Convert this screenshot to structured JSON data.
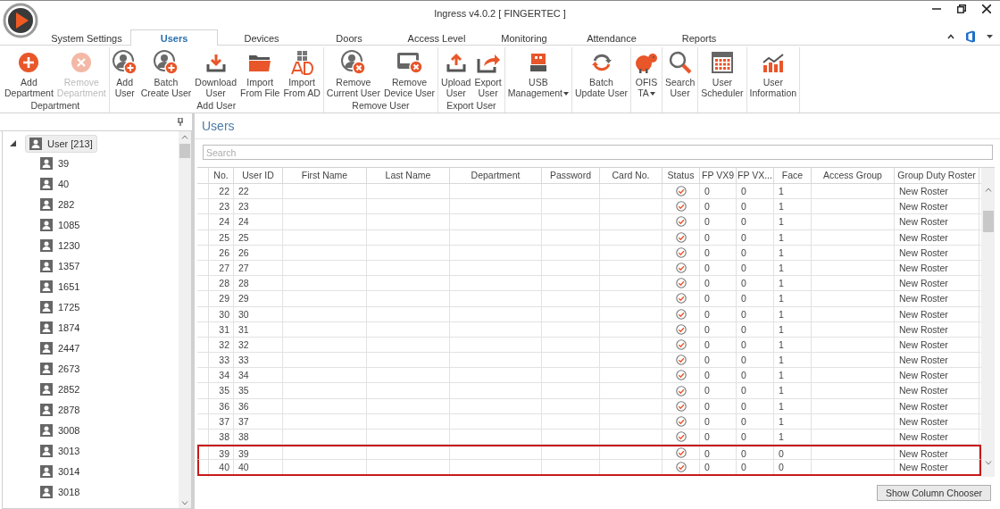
{
  "app": {
    "title": "Ingress v4.0.2 [ FINGERTEC ]"
  },
  "tabs": [
    {
      "label": "System Settings",
      "selected": false
    },
    {
      "label": "Users",
      "selected": true
    },
    {
      "label": "Devices",
      "selected": false
    },
    {
      "label": "Doors",
      "selected": false
    },
    {
      "label": "Access Level",
      "selected": false
    },
    {
      "label": "Monitoring",
      "selected": false
    },
    {
      "label": "Attendance",
      "selected": false
    },
    {
      "label": "Reports",
      "selected": false
    }
  ],
  "ribbon": {
    "groups": [
      {
        "label": "Department",
        "buttons": [
          {
            "label": "Add\nDepartment",
            "disabled": false
          },
          {
            "label": "Remove\nDepartment",
            "disabled": true
          }
        ]
      },
      {
        "label": "Add User",
        "buttons": [
          {
            "label": "Add\nUser",
            "disabled": false
          },
          {
            "label": "Batch\nCreate User",
            "disabled": false
          },
          {
            "label": "Download\nUser",
            "disabled": false
          },
          {
            "label": "Import\nFrom File",
            "disabled": false
          },
          {
            "label": "Import\nFrom AD",
            "disabled": false
          }
        ]
      },
      {
        "label": "Remove User",
        "buttons": [
          {
            "label": "Remove\nCurrent User",
            "disabled": false
          },
          {
            "label": "Remove\nDevice User",
            "disabled": false
          }
        ]
      },
      {
        "label": "Export User",
        "buttons": [
          {
            "label": "Upload\nUser",
            "disabled": false
          },
          {
            "label": "Export\nUser",
            "disabled": false
          }
        ]
      },
      {
        "buttons": [
          {
            "label": "USB\nManagement",
            "disabled": false,
            "dropdown": true
          }
        ]
      },
      {
        "buttons": [
          {
            "label": "Batch\nUpdate User",
            "disabled": false
          }
        ]
      },
      {
        "buttons": [
          {
            "label": "OFIS\nTA",
            "disabled": false,
            "dropdown": true
          }
        ]
      },
      {
        "buttons": [
          {
            "label": "Search\nUser",
            "disabled": false
          }
        ]
      },
      {
        "buttons": [
          {
            "label": "User\nScheduler",
            "disabled": false
          }
        ]
      },
      {
        "buttons": [
          {
            "label": "User\nInformation",
            "disabled": false
          }
        ]
      }
    ]
  },
  "tree": {
    "root": {
      "label": "User [213]",
      "expanded": true,
      "selected": true,
      "children": [
        {
          "label": "39",
          "selected": false
        },
        {
          "label": "40",
          "selected": false
        },
        {
          "label": "282",
          "selected": false
        },
        {
          "label": "1085",
          "selected": false
        },
        {
          "label": "1230",
          "selected": false
        },
        {
          "label": "1357",
          "selected": false
        },
        {
          "label": "1651",
          "selected": false
        },
        {
          "label": "1725",
          "selected": false
        },
        {
          "label": "1874",
          "selected": false
        },
        {
          "label": "2447",
          "selected": false
        },
        {
          "label": "2673",
          "selected": false
        },
        {
          "label": "2852",
          "selected": false
        },
        {
          "label": "2878",
          "selected": false
        },
        {
          "label": "3008",
          "selected": false
        },
        {
          "label": "3013",
          "selected": false
        },
        {
          "label": "3014",
          "selected": false
        },
        {
          "label": "3018",
          "selected": false
        }
      ]
    }
  },
  "users_panel": {
    "title": "Users",
    "search": {
      "placeholder": "Search"
    },
    "table": {
      "columns": [
        "No.",
        "User ID",
        "First Name",
        "Last Name",
        "Department",
        "Password",
        "Card No.",
        "Status",
        "FP VX9",
        "FP VX...",
        "Face",
        "Access Group",
        "Group Duty Roster"
      ],
      "rows": [
        {
          "no": "22",
          "user_id": "22",
          "fp_vx9": "0",
          "fp_vx": "0",
          "face": "1",
          "group_duty_roster": "New Roster",
          "highlighted": false
        },
        {
          "no": "23",
          "user_id": "23",
          "fp_vx9": "0",
          "fp_vx": "0",
          "face": "1",
          "group_duty_roster": "New Roster",
          "highlighted": false
        },
        {
          "no": "24",
          "user_id": "24",
          "fp_vx9": "0",
          "fp_vx": "0",
          "face": "1",
          "group_duty_roster": "New Roster",
          "highlighted": false
        },
        {
          "no": "25",
          "user_id": "25",
          "fp_vx9": "0",
          "fp_vx": "0",
          "face": "1",
          "group_duty_roster": "New Roster",
          "highlighted": false
        },
        {
          "no": "26",
          "user_id": "26",
          "fp_vx9": "0",
          "fp_vx": "0",
          "face": "1",
          "group_duty_roster": "New Roster",
          "highlighted": false
        },
        {
          "no": "27",
          "user_id": "27",
          "fp_vx9": "0",
          "fp_vx": "0",
          "face": "1",
          "group_duty_roster": "New Roster",
          "highlighted": false
        },
        {
          "no": "28",
          "user_id": "28",
          "fp_vx9": "0",
          "fp_vx": "0",
          "face": "1",
          "group_duty_roster": "New Roster",
          "highlighted": false
        },
        {
          "no": "29",
          "user_id": "29",
          "fp_vx9": "0",
          "fp_vx": "0",
          "face": "1",
          "group_duty_roster": "New Roster",
          "highlighted": false
        },
        {
          "no": "30",
          "user_id": "30",
          "fp_vx9": "0",
          "fp_vx": "0",
          "face": "1",
          "group_duty_roster": "New Roster",
          "highlighted": false
        },
        {
          "no": "31",
          "user_id": "31",
          "fp_vx9": "0",
          "fp_vx": "0",
          "face": "1",
          "group_duty_roster": "New Roster",
          "highlighted": false
        },
        {
          "no": "32",
          "user_id": "32",
          "fp_vx9": "0",
          "fp_vx": "0",
          "face": "1",
          "group_duty_roster": "New Roster",
          "highlighted": false
        },
        {
          "no": "33",
          "user_id": "33",
          "fp_vx9": "0",
          "fp_vx": "0",
          "face": "1",
          "group_duty_roster": "New Roster",
          "highlighted": false
        },
        {
          "no": "34",
          "user_id": "34",
          "fp_vx9": "0",
          "fp_vx": "0",
          "face": "1",
          "group_duty_roster": "New Roster",
          "highlighted": false
        },
        {
          "no": "35",
          "user_id": "35",
          "fp_vx9": "0",
          "fp_vx": "0",
          "face": "1",
          "group_duty_roster": "New Roster",
          "highlighted": false
        },
        {
          "no": "36",
          "user_id": "36",
          "fp_vx9": "0",
          "fp_vx": "0",
          "face": "1",
          "group_duty_roster": "New Roster",
          "highlighted": false
        },
        {
          "no": "37",
          "user_id": "37",
          "fp_vx9": "0",
          "fp_vx": "0",
          "face": "1",
          "group_duty_roster": "New Roster",
          "highlighted": false
        },
        {
          "no": "38",
          "user_id": "38",
          "fp_vx9": "0",
          "fp_vx": "0",
          "face": "1",
          "group_duty_roster": "New Roster",
          "highlighted": false
        },
        {
          "no": "39",
          "user_id": "39",
          "fp_vx9": "0",
          "fp_vx": "0",
          "face": "0",
          "group_duty_roster": "New Roster",
          "highlighted": true
        },
        {
          "no": "40",
          "user_id": "40",
          "fp_vx9": "0",
          "fp_vx": "0",
          "face": "0",
          "group_duty_roster": "New Roster",
          "highlighted": true
        }
      ]
    },
    "column_chooser_button": "Show Column Chooser"
  }
}
